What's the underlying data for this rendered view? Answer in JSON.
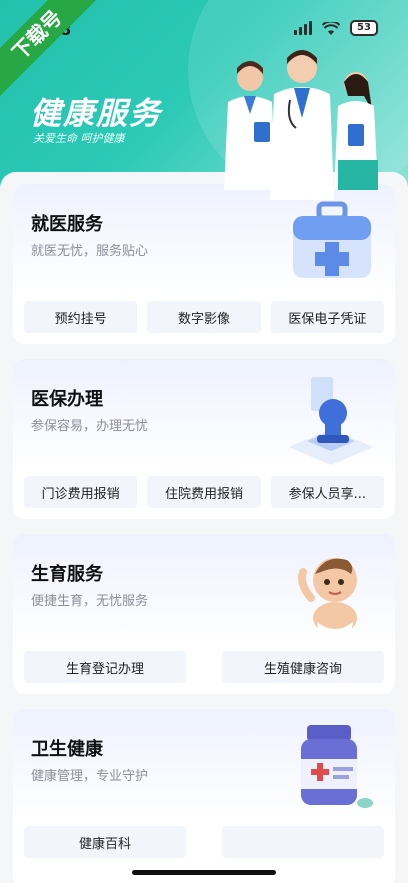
{
  "watermark": "下载号",
  "status": {
    "time": "8",
    "battery": "53"
  },
  "hero": {
    "title": "健康服务",
    "subtitle": "关爱生命 呵护健康"
  },
  "cards": [
    {
      "title": "就医服务",
      "subtitle": "就医无忧，服务贴心",
      "icon": "medical-kit-icon",
      "buttons": [
        "预约挂号",
        "数字影像",
        "医保电子凭证"
      ]
    },
    {
      "title": "医保办理",
      "subtitle": "参保容易，办理无忧",
      "icon": "stamp-icon",
      "buttons": [
        "门诊费用报销",
        "住院费用报销",
        "参保人员享..."
      ]
    },
    {
      "title": "生育服务",
      "subtitle": "便捷生育，无忧服务",
      "icon": "baby-icon",
      "buttons": [
        "生育登记办理",
        "生殖健康咨询"
      ]
    },
    {
      "title": "卫生健康",
      "subtitle": "健康管理，专业守护",
      "icon": "medicine-bottle-icon",
      "buttons": [
        "健康百科",
        ""
      ]
    }
  ],
  "colors": {
    "header": "#22c1ae",
    "watermark": "#28a745",
    "button_bg": "#f2f5fb"
  }
}
